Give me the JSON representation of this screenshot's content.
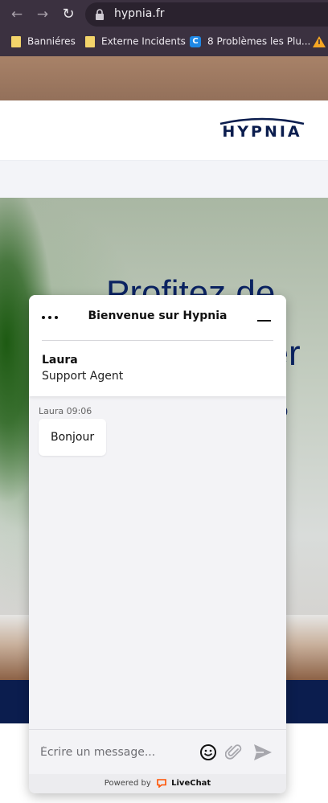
{
  "browser": {
    "url": "hypnia.fr",
    "nav_back": "←",
    "nav_forward": "→",
    "nav_reload": "↻",
    "bookmarks": [
      {
        "label": "Banniéres",
        "icon": "folder-icon"
      },
      {
        "label": "Externe Incidents",
        "icon": "folder-icon"
      },
      {
        "label": "8 Problèmes les Plu...",
        "icon": "c-icon"
      },
      {
        "label": "",
        "icon": "warning-triangle-icon"
      }
    ]
  },
  "site": {
    "logo_text": "HYPNIA",
    "headline_line1": "Profitez de",
    "headline_line2": "ner",
    "headline_line3": "o",
    "colors": {
      "navy": "#0b1d4e",
      "brand": "#0b2361"
    }
  },
  "chat": {
    "title": "Bienvenue sur Hypnia",
    "agent_name": "Laura",
    "agent_role": "Support Agent",
    "messages": [
      {
        "author": "Laura",
        "time": "09:06",
        "meta": "Laura 09:06",
        "text": "Bonjour"
      }
    ],
    "composer_placeholder": "Écrire un message...",
    "powered_by": "Powered by",
    "powered_brand": "LiveChat",
    "colors": {
      "livechat_orange": "#ff5100"
    }
  }
}
